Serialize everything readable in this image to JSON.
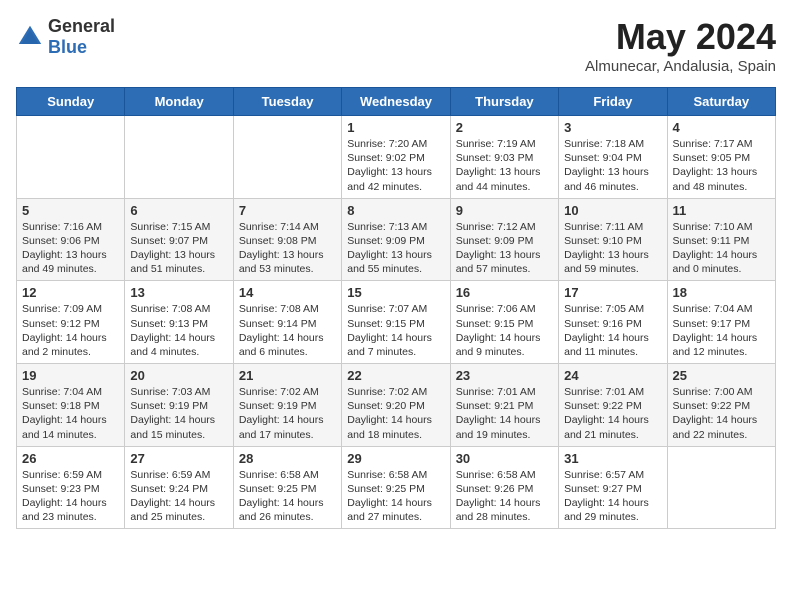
{
  "logo": {
    "general": "General",
    "blue": "Blue"
  },
  "title": "May 2024",
  "location": "Almunecar, Andalusia, Spain",
  "weekdays": [
    "Sunday",
    "Monday",
    "Tuesday",
    "Wednesday",
    "Thursday",
    "Friday",
    "Saturday"
  ],
  "weeks": [
    [
      {
        "day": "",
        "info": ""
      },
      {
        "day": "",
        "info": ""
      },
      {
        "day": "",
        "info": ""
      },
      {
        "day": "1",
        "info": "Sunrise: 7:20 AM\nSunset: 9:02 PM\nDaylight: 13 hours\nand 42 minutes."
      },
      {
        "day": "2",
        "info": "Sunrise: 7:19 AM\nSunset: 9:03 PM\nDaylight: 13 hours\nand 44 minutes."
      },
      {
        "day": "3",
        "info": "Sunrise: 7:18 AM\nSunset: 9:04 PM\nDaylight: 13 hours\nand 46 minutes."
      },
      {
        "day": "4",
        "info": "Sunrise: 7:17 AM\nSunset: 9:05 PM\nDaylight: 13 hours\nand 48 minutes."
      }
    ],
    [
      {
        "day": "5",
        "info": "Sunrise: 7:16 AM\nSunset: 9:06 PM\nDaylight: 13 hours\nand 49 minutes."
      },
      {
        "day": "6",
        "info": "Sunrise: 7:15 AM\nSunset: 9:07 PM\nDaylight: 13 hours\nand 51 minutes."
      },
      {
        "day": "7",
        "info": "Sunrise: 7:14 AM\nSunset: 9:08 PM\nDaylight: 13 hours\nand 53 minutes."
      },
      {
        "day": "8",
        "info": "Sunrise: 7:13 AM\nSunset: 9:09 PM\nDaylight: 13 hours\nand 55 minutes."
      },
      {
        "day": "9",
        "info": "Sunrise: 7:12 AM\nSunset: 9:09 PM\nDaylight: 13 hours\nand 57 minutes."
      },
      {
        "day": "10",
        "info": "Sunrise: 7:11 AM\nSunset: 9:10 PM\nDaylight: 13 hours\nand 59 minutes."
      },
      {
        "day": "11",
        "info": "Sunrise: 7:10 AM\nSunset: 9:11 PM\nDaylight: 14 hours\nand 0 minutes."
      }
    ],
    [
      {
        "day": "12",
        "info": "Sunrise: 7:09 AM\nSunset: 9:12 PM\nDaylight: 14 hours\nand 2 minutes."
      },
      {
        "day": "13",
        "info": "Sunrise: 7:08 AM\nSunset: 9:13 PM\nDaylight: 14 hours\nand 4 minutes."
      },
      {
        "day": "14",
        "info": "Sunrise: 7:08 AM\nSunset: 9:14 PM\nDaylight: 14 hours\nand 6 minutes."
      },
      {
        "day": "15",
        "info": "Sunrise: 7:07 AM\nSunset: 9:15 PM\nDaylight: 14 hours\nand 7 minutes."
      },
      {
        "day": "16",
        "info": "Sunrise: 7:06 AM\nSunset: 9:15 PM\nDaylight: 14 hours\nand 9 minutes."
      },
      {
        "day": "17",
        "info": "Sunrise: 7:05 AM\nSunset: 9:16 PM\nDaylight: 14 hours\nand 11 minutes."
      },
      {
        "day": "18",
        "info": "Sunrise: 7:04 AM\nSunset: 9:17 PM\nDaylight: 14 hours\nand 12 minutes."
      }
    ],
    [
      {
        "day": "19",
        "info": "Sunrise: 7:04 AM\nSunset: 9:18 PM\nDaylight: 14 hours\nand 14 minutes."
      },
      {
        "day": "20",
        "info": "Sunrise: 7:03 AM\nSunset: 9:19 PM\nDaylight: 14 hours\nand 15 minutes."
      },
      {
        "day": "21",
        "info": "Sunrise: 7:02 AM\nSunset: 9:19 PM\nDaylight: 14 hours\nand 17 minutes."
      },
      {
        "day": "22",
        "info": "Sunrise: 7:02 AM\nSunset: 9:20 PM\nDaylight: 14 hours\nand 18 minutes."
      },
      {
        "day": "23",
        "info": "Sunrise: 7:01 AM\nSunset: 9:21 PM\nDaylight: 14 hours\nand 19 minutes."
      },
      {
        "day": "24",
        "info": "Sunrise: 7:01 AM\nSunset: 9:22 PM\nDaylight: 14 hours\nand 21 minutes."
      },
      {
        "day": "25",
        "info": "Sunrise: 7:00 AM\nSunset: 9:22 PM\nDaylight: 14 hours\nand 22 minutes."
      }
    ],
    [
      {
        "day": "26",
        "info": "Sunrise: 6:59 AM\nSunset: 9:23 PM\nDaylight: 14 hours\nand 23 minutes."
      },
      {
        "day": "27",
        "info": "Sunrise: 6:59 AM\nSunset: 9:24 PM\nDaylight: 14 hours\nand 25 minutes."
      },
      {
        "day": "28",
        "info": "Sunrise: 6:58 AM\nSunset: 9:25 PM\nDaylight: 14 hours\nand 26 minutes."
      },
      {
        "day": "29",
        "info": "Sunrise: 6:58 AM\nSunset: 9:25 PM\nDaylight: 14 hours\nand 27 minutes."
      },
      {
        "day": "30",
        "info": "Sunrise: 6:58 AM\nSunset: 9:26 PM\nDaylight: 14 hours\nand 28 minutes."
      },
      {
        "day": "31",
        "info": "Sunrise: 6:57 AM\nSunset: 9:27 PM\nDaylight: 14 hours\nand 29 minutes."
      },
      {
        "day": "",
        "info": ""
      }
    ]
  ]
}
